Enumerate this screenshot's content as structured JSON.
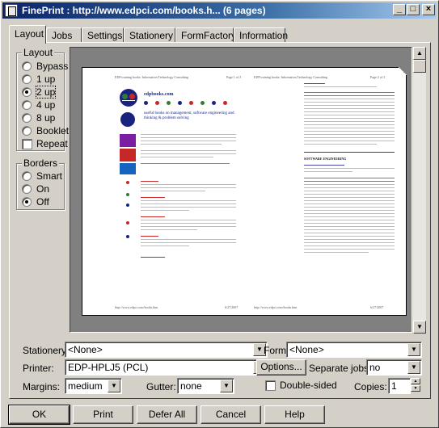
{
  "window": {
    "title": "FinePrint : http://www.edpci.com/books.h... (6 pages)",
    "minimize": "_",
    "maximize": "□",
    "close": "×"
  },
  "tabs": [
    {
      "label": "Layout"
    },
    {
      "label": "Jobs"
    },
    {
      "label": "Settings"
    },
    {
      "label": "Stationery"
    },
    {
      "label": "FormFactory"
    },
    {
      "label": "Information"
    }
  ],
  "layout_group": {
    "title": "Layout",
    "options": [
      {
        "label": "Bypass",
        "selected": false
      },
      {
        "label": "1 up",
        "selected": false
      },
      {
        "label": "2 up",
        "selected": true
      },
      {
        "label": "4 up",
        "selected": false
      },
      {
        "label": "8 up",
        "selected": false
      },
      {
        "label": "Booklet",
        "selected": false
      }
    ],
    "repeat_label": "Repeat",
    "repeat_checked": false
  },
  "borders_group": {
    "title": "Borders",
    "options": [
      {
        "label": "Smart",
        "selected": false
      },
      {
        "label": "On",
        "selected": false
      },
      {
        "label": "Off",
        "selected": true
      }
    ]
  },
  "preview": {
    "left_page": {
      "header_left": "EDP training books: Information Technology Consulting",
      "header_right": "Page 1 of 3",
      "brand": "edpbooks.com",
      "tagline": "useful books on management, software engineering and thinking & problem solving",
      "footer_left": "http://www.edpci.com/books.htm",
      "footer_right": "6/27/2007"
    },
    "right_page": {
      "header_left": "EDP training books: Information Technology Consulting",
      "header_right": "Page 2 of 3",
      "section": "SOFTWARE ENGINEERING",
      "footer_left": "http://www.edpci.com/books.htm",
      "footer_right": "6/27/2007"
    }
  },
  "fields": {
    "stationery_label": "Stationery:",
    "stationery_value": "<None>",
    "form_label": "Form:",
    "form_value": "<None>",
    "printer_label": "Printer:",
    "printer_value": "EDP-HPLJ5 (PCL)",
    "options_button": "Options...",
    "separate_jobs_label": "Separate jobs:",
    "separate_jobs_value": "no",
    "margins_label": "Margins:",
    "margins_value": "medium",
    "gutter_label": "Gutter:",
    "gutter_value": "none",
    "double_sided_label": "Double-sided",
    "double_sided_checked": false,
    "copies_label": "Copies:",
    "copies_value": "1"
  },
  "buttons": {
    "ok": "OK",
    "print": "Print",
    "defer_all": "Defer All",
    "cancel": "Cancel",
    "help": "Help"
  },
  "colors": {
    "titlebar_start": "#0a246a",
    "titlebar_end": "#a6caf0",
    "face": "#d4d0c8",
    "preview_bg": "#808080"
  }
}
